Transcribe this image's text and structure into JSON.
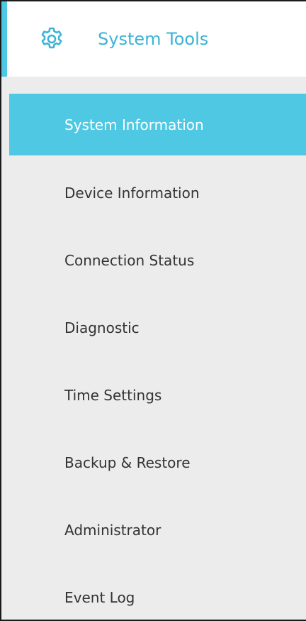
{
  "header": {
    "title": "System Tools",
    "icon": "gear-icon",
    "accent_color": "#4ec8e3",
    "title_color": "#3bb3d6"
  },
  "menu": {
    "active_index": 0,
    "active_color": "#4ec8e3",
    "items": [
      {
        "label": "System Information"
      },
      {
        "label": "Device Information"
      },
      {
        "label": "Connection Status"
      },
      {
        "label": "Diagnostic"
      },
      {
        "label": "Time Settings"
      },
      {
        "label": "Backup & Restore"
      },
      {
        "label": "Administrator"
      },
      {
        "label": "Event Log"
      }
    ]
  }
}
